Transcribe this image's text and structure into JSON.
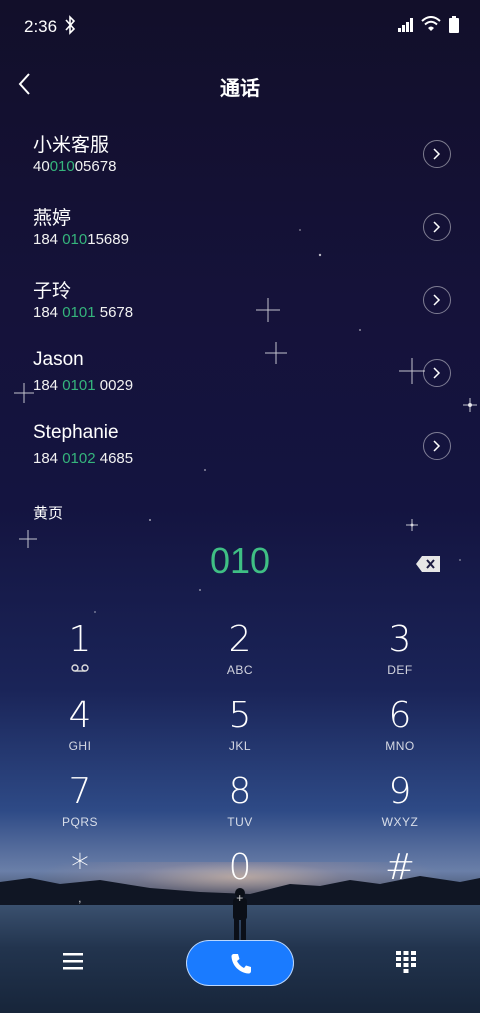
{
  "status_bar": {
    "time": "2:36"
  },
  "header": {
    "title": "通话"
  },
  "contacts": [
    {
      "name": "小米客服",
      "number_pre": "40",
      "number_hl": "010",
      "number_post": "05678"
    },
    {
      "name": "燕婷",
      "number_pre": "184 ",
      "number_hl": "010",
      "number_post": "15689"
    },
    {
      "name": "子玲",
      "number_pre": "184 ",
      "number_hl": "0101",
      "number_post": " 5678"
    },
    {
      "name": "Jason",
      "number_pre": "184 ",
      "number_hl": "0101",
      "number_post": " 0029"
    },
    {
      "name": "Stephanie",
      "number_pre": "184 ",
      "number_hl": "0102",
      "number_post": " 4685"
    }
  ],
  "yellow_pages_label": "黄页",
  "dialed_number": "010",
  "keypad": [
    {
      "digit": "1",
      "letters": ""
    },
    {
      "digit": "2",
      "letters": "ABC"
    },
    {
      "digit": "3",
      "letters": "DEF"
    },
    {
      "digit": "4",
      "letters": "GHI"
    },
    {
      "digit": "5",
      "letters": "JKL"
    },
    {
      "digit": "6",
      "letters": "MNO"
    },
    {
      "digit": "7",
      "letters": "PQRS"
    },
    {
      "digit": "8",
      "letters": "TUV"
    },
    {
      "digit": "9",
      "letters": "WXYZ"
    },
    {
      "digit": "*",
      "letters": ","
    },
    {
      "digit": "0",
      "letters": "+"
    },
    {
      "digit": "#",
      "letters": ""
    }
  ],
  "icons": {
    "bluetooth": "bluetooth-icon",
    "signal": "signal-icon",
    "wifi": "wifi-icon",
    "battery": "battery-icon",
    "back": "back-icon",
    "chevron": "chevron-right-icon",
    "backspace": "backspace-icon",
    "voicemail": "voicemail-icon",
    "menu": "menu-icon",
    "call": "phone-icon",
    "keypad_toggle": "keypad-icon"
  },
  "colors": {
    "highlight": "#35b57c",
    "call_button": "#1a7bff"
  }
}
